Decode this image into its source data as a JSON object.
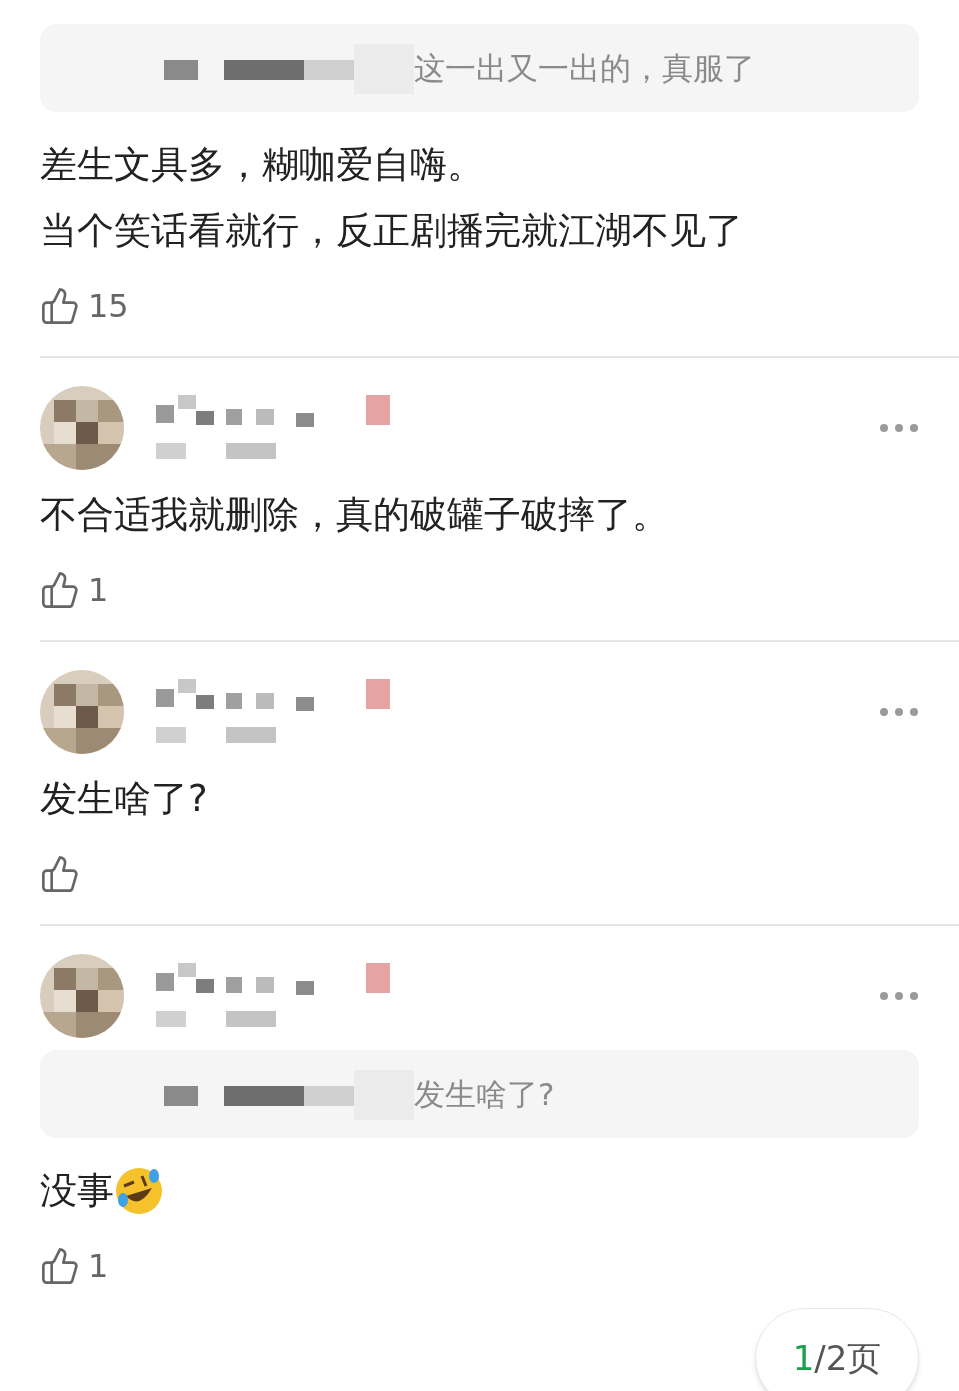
{
  "comments": [
    {
      "kind": "continued",
      "quote": {
        "text": "这一出又一出的，真服了"
      },
      "lines": [
        "差生文具多，糊咖爱自嗨。",
        "当个笑话看就行，反正剧播完就江湖不见了"
      ],
      "likes": "15"
    },
    {
      "kind": "full",
      "lines": [
        "不合适我就删除，真的破罐子破摔了。"
      ],
      "likes": "1"
    },
    {
      "kind": "full",
      "lines": [
        "发生啥了?"
      ]
    },
    {
      "kind": "full",
      "quote": {
        "text": "发生啥了?"
      },
      "lines": [
        "没事"
      ],
      "emoji": true,
      "likes": "1"
    }
  ],
  "pager": {
    "current": "1",
    "rest": "/2页"
  }
}
